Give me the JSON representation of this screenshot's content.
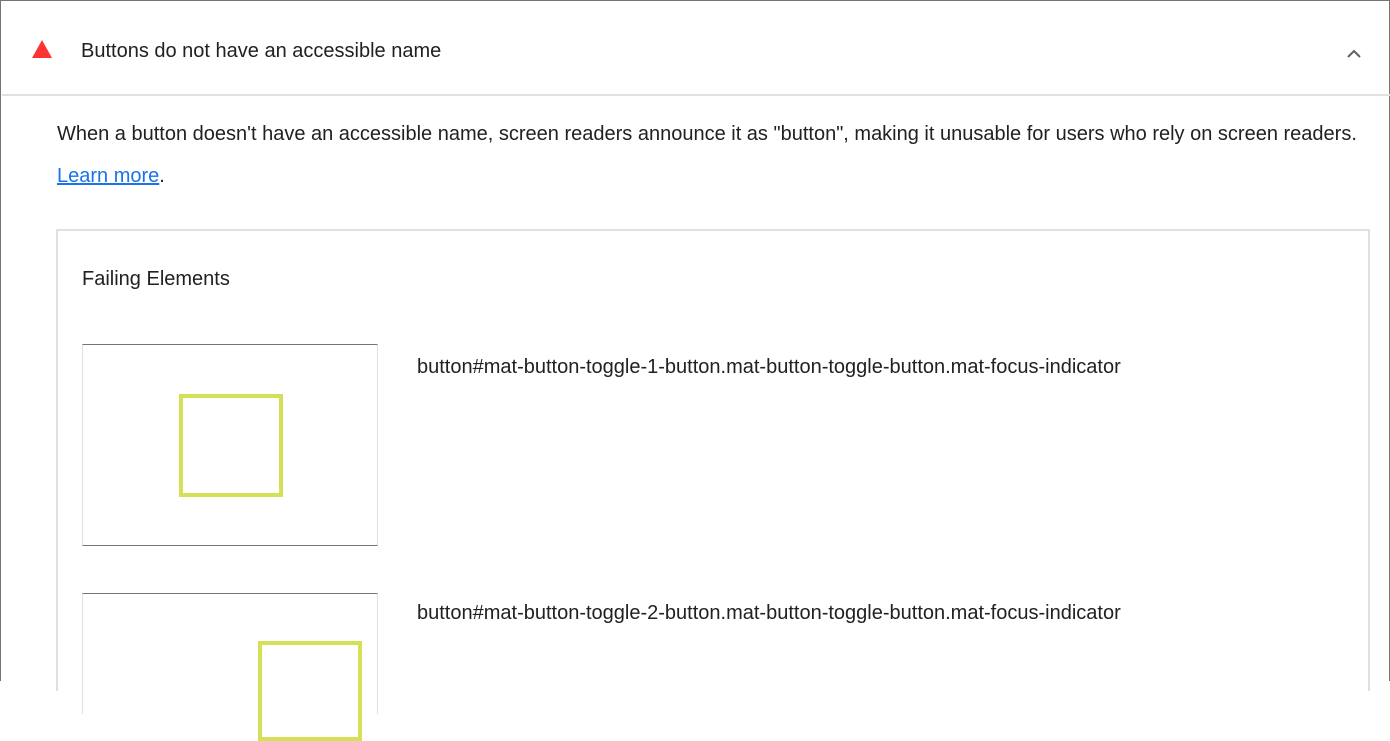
{
  "audit": {
    "title": "Buttons do not have an accessible name",
    "status_icon": "warning-triangle-icon",
    "status_color": "#ff3333",
    "expanded": true,
    "toggle_icon": "chevron-up-icon"
  },
  "description": {
    "text": "When a button doesn't have an accessible name, screen readers announce it as \"button\", making it unusable for users who rely on screen readers. ",
    "link_text": "Learn more",
    "trailing": "."
  },
  "failing": {
    "title": "Failing Elements",
    "highlight_color": "#d4e157",
    "items": [
      {
        "selector": "button#mat-button-toggle-1-button.mat-button-toggle-button.mat-focus-indicator"
      },
      {
        "selector": "button#mat-button-toggle-2-button.mat-button-toggle-button.mat-focus-indicator"
      }
    ]
  }
}
